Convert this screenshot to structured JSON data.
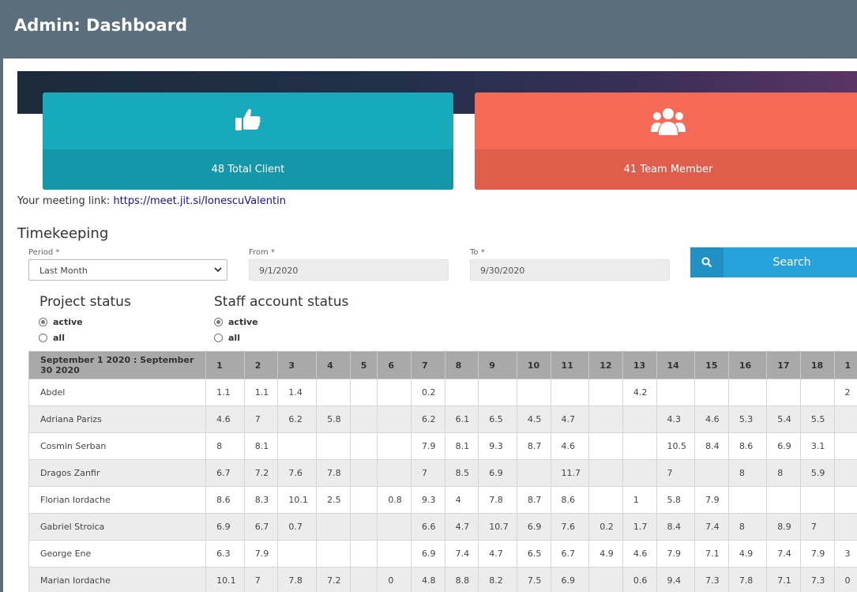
{
  "header": {
    "title": "Admin: Dashboard"
  },
  "cards": {
    "client": {
      "label": "48 Total Client",
      "icon": "thumbs-up-icon",
      "color": "#17a9bc"
    },
    "team": {
      "label": "41 Team Member",
      "icon": "users-icon",
      "color": "#f56a55"
    }
  },
  "meeting": {
    "label": "Your meeting link:",
    "link": "https://meet.jit.si/IonescuValentin"
  },
  "timekeeping": {
    "title": "Timekeeping",
    "period": {
      "label": "Period *",
      "value": "Last Month"
    },
    "from": {
      "label": "From *",
      "value": "9/1/2020"
    },
    "to": {
      "label": "To *",
      "value": "9/30/2020"
    },
    "search_label": "Search"
  },
  "project_status": {
    "title": "Project status",
    "options": [
      "active",
      "all"
    ],
    "selected": "active"
  },
  "staff_status": {
    "title": "Staff account status",
    "options": [
      "active",
      "all"
    ],
    "selected": "active"
  },
  "table": {
    "range_header": "September 1 2020 : September 30 2020",
    "days": [
      "1",
      "2",
      "3",
      "4",
      "5",
      "6",
      "7",
      "8",
      "9",
      "10",
      "11",
      "12",
      "13",
      "14",
      "15",
      "16",
      "17",
      "18",
      "1"
    ],
    "rows": [
      {
        "name": "Abdel",
        "values": [
          "1.1",
          "1.1",
          "1.4",
          "",
          "",
          "",
          "0.2",
          "",
          "",
          "",
          "",
          "",
          "4.2",
          "",
          "",
          "",
          "",
          "",
          "2"
        ]
      },
      {
        "name": "Adriana Parizs",
        "values": [
          "4.6",
          "7",
          "6.2",
          "5.8",
          "",
          "",
          "6.2",
          "6.1",
          "6.5",
          "4.5",
          "4.7",
          "",
          "",
          "4.3",
          "4.6",
          "5.3",
          "5.4",
          "5.5",
          ""
        ]
      },
      {
        "name": "Cosmin Serban",
        "values": [
          "8",
          "8.1",
          "",
          "",
          "",
          "",
          "7.9",
          "8.1",
          "9.3",
          "8.7",
          "4.6",
          "",
          "",
          "10.5",
          "8.4",
          "8.6",
          "6.9",
          "3.1",
          ""
        ]
      },
      {
        "name": "Dragos Zanfir",
        "values": [
          "6.7",
          "7.2",
          "7.6",
          "7.8",
          "",
          "",
          "7",
          "8.5",
          "6.9",
          "",
          "11.7",
          "",
          "",
          "7",
          "",
          "8",
          "8",
          "5.9",
          ""
        ]
      },
      {
        "name": "Florian Iordache",
        "values": [
          "8.6",
          "8.3",
          "10.1",
          "2.5",
          "",
          "0.8",
          "9.3",
          "4",
          "7.8",
          "8.7",
          "8.6",
          "",
          "1",
          "5.8",
          "7.9",
          "",
          "",
          "",
          ""
        ]
      },
      {
        "name": "Gabriel Stroica",
        "values": [
          "6.9",
          "6.7",
          "0.7",
          "",
          "",
          "",
          "6.6",
          "4.7",
          "10.7",
          "6.9",
          "7.6",
          "0.2",
          "1.7",
          "8.4",
          "7.4",
          "8",
          "8.9",
          "7",
          ""
        ]
      },
      {
        "name": "George Ene",
        "values": [
          "6.3",
          "7.9",
          "",
          "",
          "",
          "",
          "6.9",
          "7.4",
          "4.7",
          "6.5",
          "6.7",
          "4.9",
          "4.6",
          "7.9",
          "7.1",
          "4.9",
          "7.4",
          "7.9",
          "3"
        ]
      },
      {
        "name": "Marian Iordache",
        "values": [
          "10.1",
          "7",
          "7.8",
          "7.2",
          "",
          "0",
          "4.8",
          "8.8",
          "8.2",
          "7.5",
          "6.9",
          "",
          "0.6",
          "9.4",
          "7.3",
          "7.8",
          "7.1",
          "7.3",
          "0"
        ]
      }
    ]
  }
}
